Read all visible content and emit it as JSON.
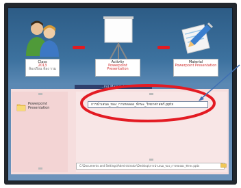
{
  "steps": {
    "class": {
      "title": "Class",
      "code": "2013",
      "sub": "ห้องเรียน ห้อง รวม"
    },
    "activity": {
      "title": "Activity",
      "line1": "Powerpoint",
      "line2": "Presentation"
    },
    "material": {
      "title": "Material",
      "line1": "Powerpoint Presentation"
    }
  },
  "list_panel": {
    "tab_label": "...ing Materials",
    "folder_label_1": "Powerpoint",
    "folder_label_2": "Presentation",
    "selected_file": "การนำเสนอ_ของ_การทดลอง_ทักษะ_วิทยาศาสตร์.pptx",
    "path": "C:\\Documents and Settings\\Administrator\\Desktop\\การนำเสนอ_ของ_การทดลอง_ทักษะ.pptx"
  },
  "colors": {
    "accent_red": "#e11b22",
    "panel_blue": "#3d729f",
    "highlight_ellipse": "#e31b23",
    "pointer_arrow": "#3f6fb2"
  }
}
